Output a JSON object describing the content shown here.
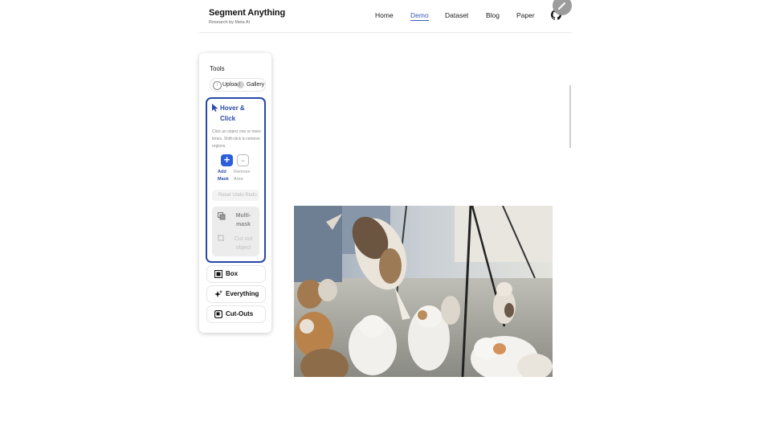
{
  "header": {
    "brand_title": "Segment Anything",
    "brand_subtitle": "Research by Meta AI",
    "nav": [
      "Home",
      "Demo",
      "Dataset",
      "Blog",
      "Paper"
    ],
    "active_nav": "Demo"
  },
  "tools": {
    "title": "Tools",
    "upload_label": "Upload",
    "gallery_label": "Gallery",
    "hover_click": {
      "title": "Hover & Click",
      "description": "Click an object one or more times. Shift-click to remove regions.",
      "add_label": "Add Mask",
      "remove_label": "Remove Area",
      "reset_label": "Reset Undo Redo",
      "multimask_label": "Multi-mask",
      "cutout_label": "Cut out object"
    },
    "box_label": "Box",
    "everything_label": "Everything",
    "cutouts_label": "Cut-Outs"
  },
  "image": {
    "subject": "cats-jumping-photo"
  },
  "colors": {
    "accent": "#2948a8",
    "add_button": "#2b5fd9",
    "nav_active": "#3b5bb5"
  }
}
